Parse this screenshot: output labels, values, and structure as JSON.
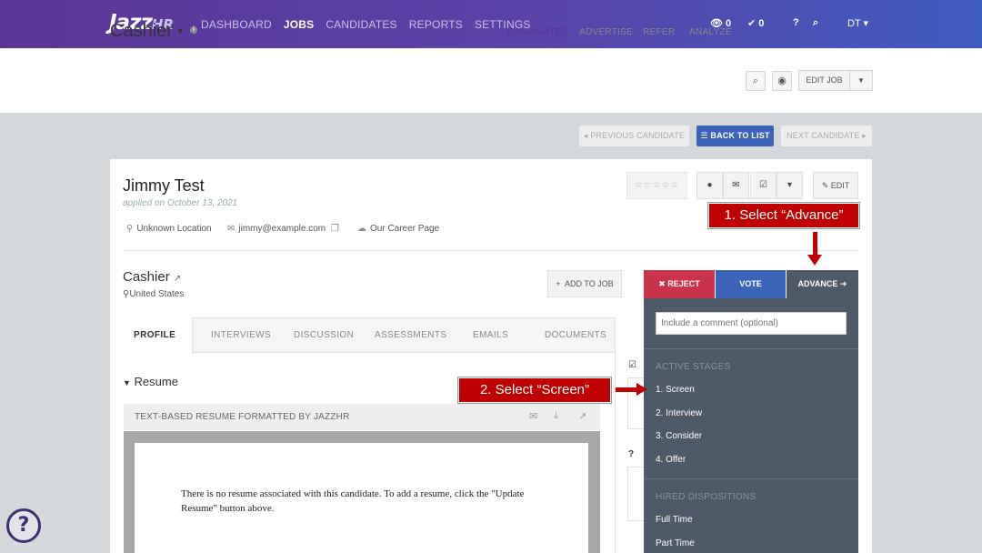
{
  "nav": {
    "logo_main": "Jazz",
    "logo_hr": "HR",
    "links": [
      "DASHBOARD",
      "JOBS",
      "CANDIDATES",
      "REPORTS",
      "SETTINGS"
    ],
    "views_count": "0",
    "tasks_count": "0",
    "user_initials": "DT"
  },
  "job": {
    "title": "Cashier",
    "tabs": [
      "CANDIDATES",
      "ADVERTISE",
      "REFER",
      "ANALYZE"
    ],
    "edit_label": "EDIT JOB"
  },
  "candidate_nav": {
    "prev": "PREVIOUS CANDIDATE",
    "back": "BACK TO LIST",
    "next": "NEXT CANDIDATE"
  },
  "candidate": {
    "name": "Jimmy Test",
    "applied": "applied on October 13, 2021",
    "location": "Unknown Location",
    "email": "jimmy@example.com",
    "source": "Our Career Page",
    "edit_label": "EDIT",
    "job_name": "Cashier",
    "job_location": "United States",
    "add_to_job": "ADD TO JOB",
    "reject": "REJECT",
    "vote": "VOTE",
    "advance": "ADVANCE"
  },
  "tabs": [
    "PROFILE",
    "INTERVIEWS",
    "DISCUSSION",
    "ASSESSMENTS",
    "EMAILS",
    "DOCUMENTS"
  ],
  "resume": {
    "heading": "Resume",
    "bar_label": "TEXT-BASED RESUME FORMATTED BY JAZZHR",
    "message": "There is no resume associated with this candidate. To add a resume, click the \"Update Resume\" button above."
  },
  "dropdown": {
    "placeholder": "Include a comment (optional)",
    "active_heading": "ACTIVE STAGES",
    "active_items": [
      "1. Screen",
      "2. Interview",
      "3. Consider",
      "4. Offer"
    ],
    "hired_heading": "HIRED DISPOSITIONS",
    "hired_items": [
      "Full Time",
      "Part Time"
    ]
  },
  "annotations": {
    "step1": "1. Select “Advance”",
    "step2": "2. Select “Screen”"
  },
  "colors": {
    "brand_purple": "#5b3596",
    "reject_red": "#c9344a",
    "vote_blue": "#3a64b8",
    "advance_gray": "#4e5a68",
    "annotation_red": "#c00000"
  }
}
